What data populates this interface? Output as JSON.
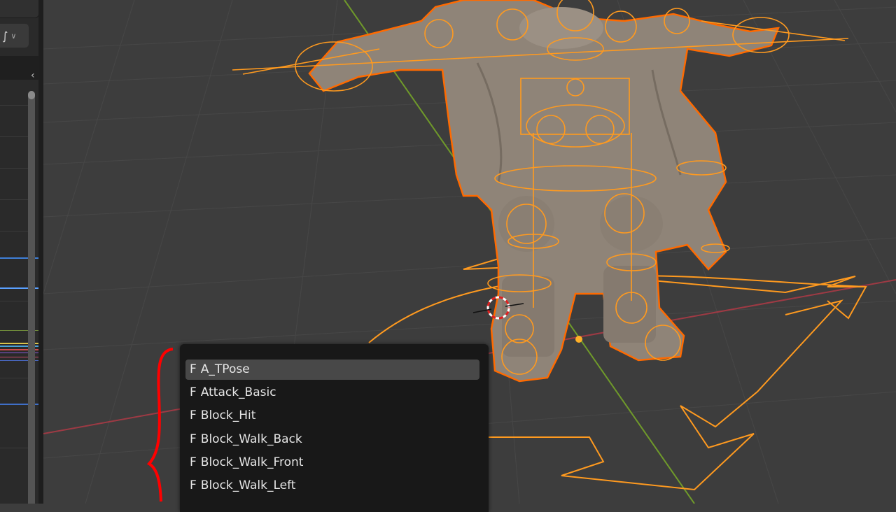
{
  "left_panel": {
    "curve_icon_glyph": "∫̲",
    "curve_icon": "fcurve-icon",
    "collapse_glyph": "<"
  },
  "action_menu": {
    "items": [
      {
        "flag": "F",
        "label": "A_TPose",
        "active": true
      },
      {
        "flag": "F",
        "label": "Attack_Basic",
        "active": false
      },
      {
        "flag": "F",
        "label": "Block_Hit",
        "active": false
      },
      {
        "flag": "F",
        "label": "Block_Walk_Back",
        "active": false
      },
      {
        "flag": "F",
        "label": "Block_Walk_Front",
        "active": false
      },
      {
        "flag": "F",
        "label": "Block_Walk_Left",
        "active": false
      }
    ]
  },
  "colors": {
    "rig_orange": "#ff9a1f",
    "outline_orange": "#ff6a00",
    "axis_green": "#6f9a2a",
    "axis_red": "#9e3a44",
    "annotation_red": "#ff0000",
    "menu_bg": "#181818",
    "menu_active": "#484848"
  }
}
